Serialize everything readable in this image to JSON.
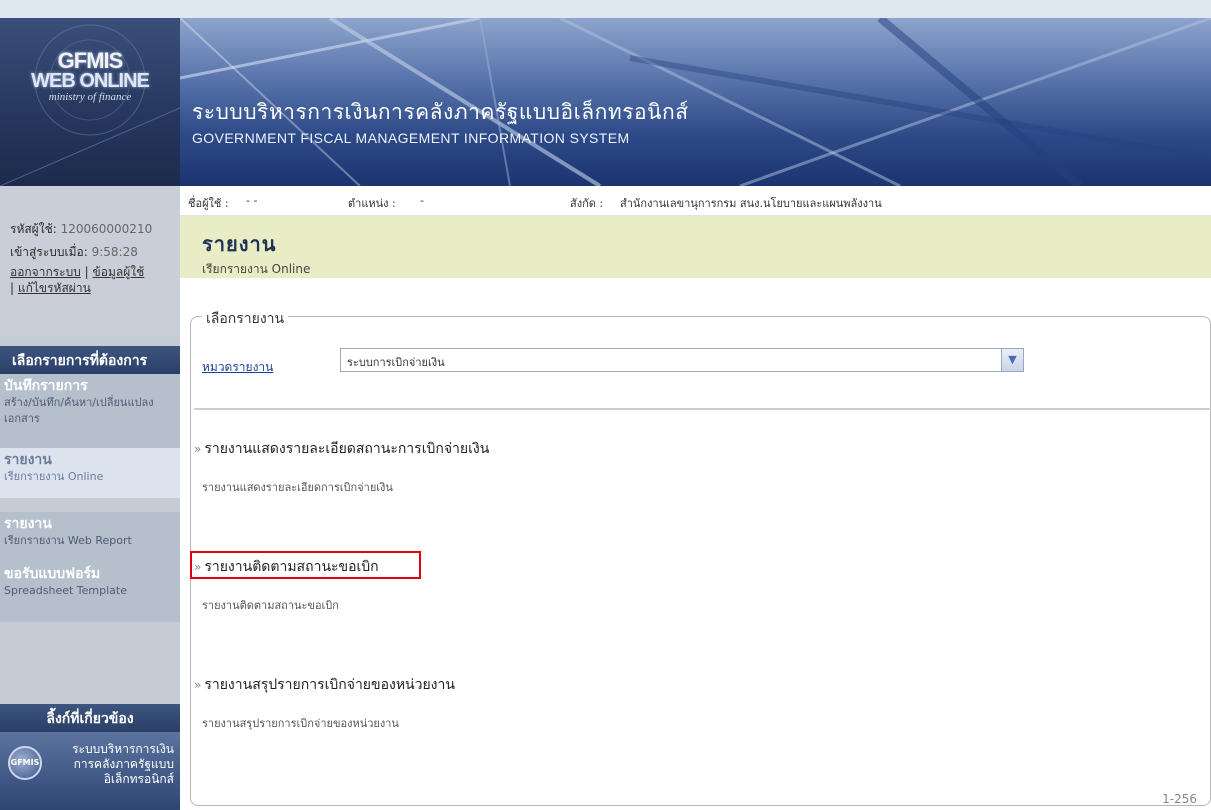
{
  "banner": {
    "logo_line1": "GFMIS",
    "logo_line2": "WEB ONLINE",
    "logo_line3": "ministry of finance",
    "title_th": "ระบบบริหารการเงินการคลังภาครัฐแบบอิเล็กทรอนิกส์",
    "title_en": "GOVERNMENT FISCAL MANAGEMENT INFORMATION SYSTEM"
  },
  "sidebar": {
    "user_id_label": "รหัสผู้ใช้:",
    "user_id_value": "120060000210",
    "login_time_label": "เข้าสู่ระบบเมื่อ:",
    "login_time_value": "9:58:28",
    "logout_link": "ออกจากระบบ",
    "user_info_link": "ข้อมูลผู้ใช้",
    "change_password_link": "แก้ไขรหัสผ่าน",
    "separator": "|",
    "menu_header": "เลือกรายการที่ต้องการ",
    "menu_items": [
      {
        "title": "บันทึกรายการ",
        "subtitle": "สร้าง/บันทึก/ค้นหา/เปลี่ยนแปลง เอกสาร"
      },
      {
        "title": "รายงาน",
        "subtitle": "เรียกรายงาน Online"
      },
      {
        "title": "รายงาน",
        "subtitle": "เรียกรายงาน Web Report"
      },
      {
        "title": "ขอรับแบบฟอร์ม",
        "subtitle": "Spreadsheet Template"
      }
    ],
    "links_header": "ลิ้งก์ที่เกี่ยวข้อง",
    "links_emblem": "GFMIS",
    "links_text": "ระบบบริหารการเงินการคลังภาครัฐแบบอิเล็กทรอนิกส์"
  },
  "userbar": {
    "username_label": "ชื่อผู้ใช้ :",
    "username_value": "- -",
    "position_label": "ตำแหน่ง :",
    "position_value": "-",
    "affiliation_label": "สังกัด :",
    "affiliation_value": "สำนักงานเลขานุการกรม สนง.นโยบายและแผนพลังงาน"
  },
  "page": {
    "title": "รายงาน",
    "subtitle": "เรียกรายงาน Online",
    "section_legend": "เลือกรายงาน",
    "category_label": "หมวดรายงาน",
    "category_value": "ระบบการเบิกจ่ายเงิน",
    "bullet": "»",
    "reports": [
      {
        "title": "รายงานแสดงรายละเอียดสถานะการเบิกจ่ายเงิน",
        "desc": "รายงานแสดงรายละเอียดการเบิกจ่ายเงิน"
      },
      {
        "title": "รายงานติดตามสถานะขอเบิก",
        "desc": "รายงานติดตามสถานะขอเบิก"
      },
      {
        "title": "รายงานสรุปรายการเบิกจ่ายของหน่วยงาน",
        "desc": "รายงานสรุปรายการเบิกจ่ายของหน่วยงาน"
      }
    ],
    "page_number": "1-256"
  },
  "colors": {
    "highlight_border": "#e1000f",
    "title_bar_bg": "#e9edc5",
    "menu_header_bg": "#2a3f68"
  }
}
